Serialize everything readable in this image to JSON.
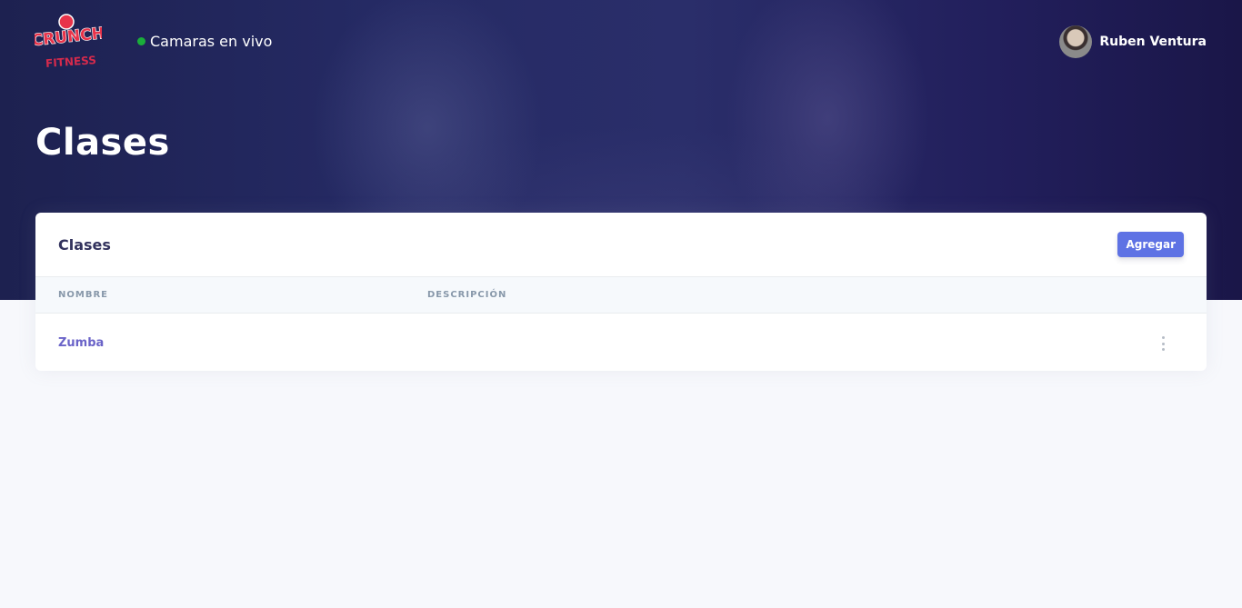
{
  "brand": {
    "logo_line1": "CRUNCH",
    "logo_line2": "FITNESS",
    "logo_colors": {
      "primary": "#e8334a",
      "outline": "#ffffff",
      "secondary": "#d62a4c"
    }
  },
  "nav": {
    "live_cameras_label": "Camaras en vivo",
    "live_indicator_color": "#1aae3a"
  },
  "user": {
    "name": "Ruben Ventura",
    "avatar_icon": "user-avatar-photo"
  },
  "page": {
    "title": "Clases"
  },
  "card": {
    "title": "Clases",
    "add_button_label": "Agregar",
    "accent_color": "#5e72e4",
    "columns": [
      "NOMBRE",
      "DESCRIPCIÓN"
    ],
    "rows": [
      {
        "name": "Zumba",
        "description": "",
        "actions_icon": "kebab-menu-icon"
      }
    ]
  }
}
